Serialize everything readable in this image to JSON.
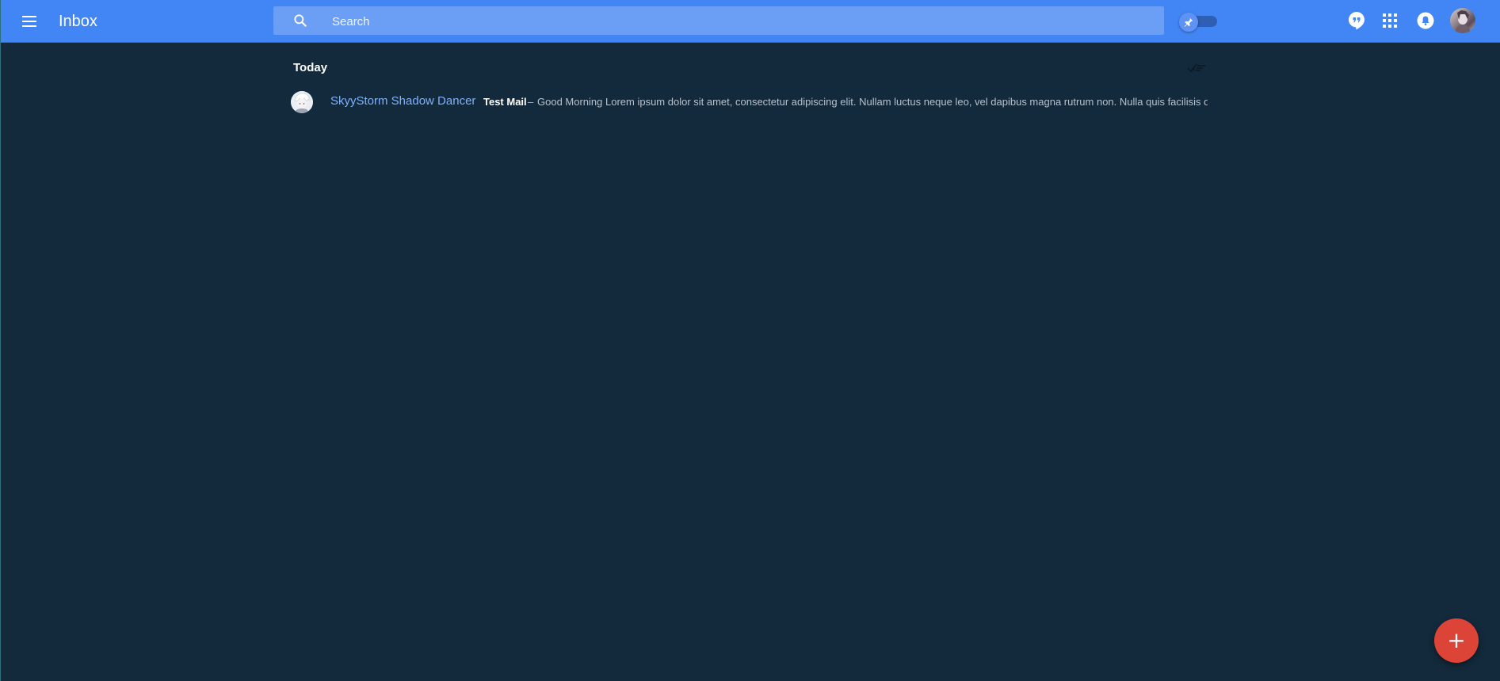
{
  "header": {
    "title": "Inbox",
    "search_placeholder": "Search",
    "pin_toggle_state": "off",
    "icons": [
      "menu-icon",
      "search-icon",
      "pin-icon",
      "hangouts-icon",
      "apps-grid-icon",
      "notifications-bell-icon",
      "account-avatar"
    ]
  },
  "main": {
    "section_title": "Today",
    "messages": [
      {
        "sender": "SkyyStorm Shadow Dancer",
        "subject": "Test Mail",
        "separator": "–",
        "snippet": "Good Morning Lorem ipsum dolor sit amet, consectetur adipiscing elit. Nullam luctus neque leo, vel dapibus magna rutrum non. Nulla quis facilisis dia..."
      }
    ]
  },
  "fab": {
    "label": "+"
  },
  "colors": {
    "header_bg": "#4285f4",
    "search_bg": "#6b9ff6",
    "page_bg": "#132a3c",
    "sender_link": "#7fb1ff",
    "fab_bg": "#db4437"
  }
}
